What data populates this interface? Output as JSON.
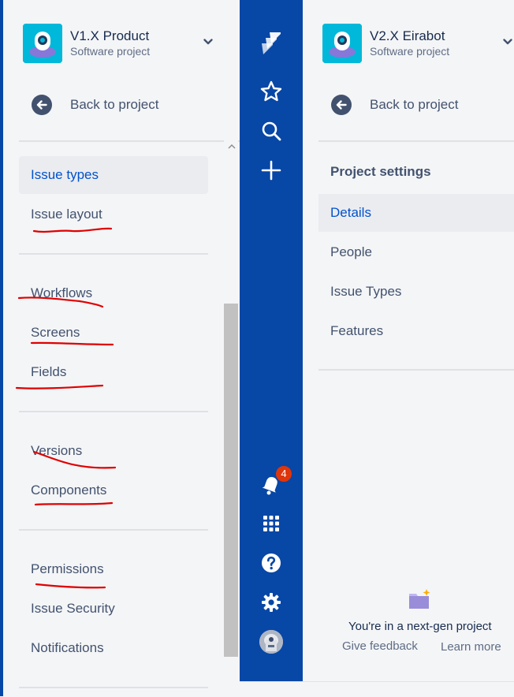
{
  "left_sidebar": {
    "project_name": "V1.X Product",
    "project_type": "Software project",
    "back_label": "Back to project",
    "items": [
      {
        "label": "Issue types",
        "active": true
      },
      {
        "label": "Issue layout"
      },
      {
        "label": "Workflows"
      },
      {
        "label": "Screens"
      },
      {
        "label": "Fields"
      },
      {
        "label": "Versions"
      },
      {
        "label": "Components"
      },
      {
        "label": "Permissions"
      },
      {
        "label": "Issue Security"
      },
      {
        "label": "Notifications"
      }
    ],
    "annotation_color": "#e00000"
  },
  "global_nav": {
    "icons": [
      "jira-logo-icon",
      "star-icon",
      "search-icon",
      "plus-icon",
      "bell-icon",
      "app-switcher-icon",
      "help-icon",
      "settings-icon",
      "user-avatar"
    ],
    "notification_count": "4",
    "background": "#0747a6"
  },
  "right_sidebar": {
    "project_name": "V2.X Eirabot",
    "project_type": "Software project",
    "back_label": "Back to project",
    "section_title": "Project settings",
    "items": [
      {
        "label": "Details",
        "active": true
      },
      {
        "label": "People"
      },
      {
        "label": "Issue Types"
      },
      {
        "label": "Features"
      }
    ],
    "footer": {
      "text": "You're in a next-gen project",
      "feedback": "Give feedback",
      "learn_more": "Learn more"
    }
  }
}
